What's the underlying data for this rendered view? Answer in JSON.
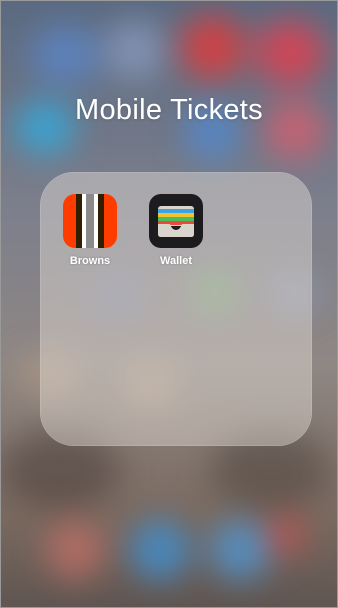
{
  "folder": {
    "title": "Mobile Tickets"
  },
  "apps": [
    {
      "label": "Browns",
      "icon": "browns-helmet-stripes-icon",
      "colors": {
        "orange": "#ff3c00",
        "brown": "#311d00",
        "white": "#ffffff",
        "gray": "#8a8a8a"
      }
    },
    {
      "label": "Wallet",
      "icon": "wallet-cards-icon",
      "colors": {
        "background": "#1c1c1e",
        "card_blue": "#3fa3e0",
        "card_yellow": "#f2c230",
        "card_green": "#48c05a",
        "card_red": "#ee4a3c",
        "pocket": "#d9d4cc"
      }
    }
  ]
}
